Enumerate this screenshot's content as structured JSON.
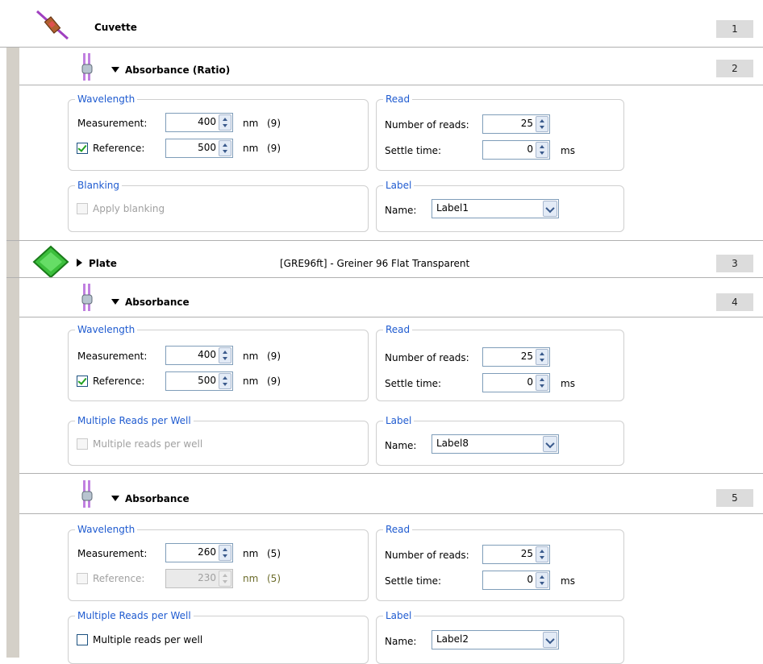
{
  "colors": {
    "legend": "#1f5bd0",
    "gutter": "#d4d0c8",
    "number_badge": "#dcdcdc",
    "check": "#21a121"
  },
  "steps": [
    {
      "number": "1",
      "title": "Cuvette",
      "icon": "cuvette-icon"
    },
    {
      "number": "2",
      "title": "Absorbance (Ratio)",
      "icon": "absorbance-probe-icon",
      "wavelength": {
        "legend": "Wavelength",
        "measurement_label": "Measurement:",
        "measurement_value": "400",
        "measurement_unit": "nm",
        "measurement_index": "(9)",
        "reference_label": "Reference:",
        "reference_checked": true,
        "reference_value": "500",
        "reference_unit": "nm",
        "reference_index": "(9)"
      },
      "read": {
        "legend": "Read",
        "reads_label": "Number of reads:",
        "reads_value": "25",
        "settle_label": "Settle time:",
        "settle_value": "0",
        "settle_unit": "ms"
      },
      "option": {
        "legend": "Blanking",
        "label": "Apply blanking",
        "checked": false,
        "enabled": false
      },
      "label": {
        "legend": "Label",
        "name_label": "Name:",
        "name_value": "Label1"
      }
    },
    {
      "number": "3",
      "title": "Plate",
      "icon": "plate-icon",
      "description": "[GRE96ft] - Greiner 96 Flat Transparent"
    },
    {
      "number": "4",
      "title": "Absorbance",
      "icon": "absorbance-probe-icon",
      "wavelength": {
        "legend": "Wavelength",
        "measurement_label": "Measurement:",
        "measurement_value": "400",
        "measurement_unit": "nm",
        "measurement_index": "(9)",
        "reference_label": "Reference:",
        "reference_checked": true,
        "reference_value": "500",
        "reference_unit": "nm",
        "reference_index": "(9)"
      },
      "read": {
        "legend": "Read",
        "reads_label": "Number of reads:",
        "reads_value": "25",
        "settle_label": "Settle time:",
        "settle_value": "0",
        "settle_unit": "ms"
      },
      "option": {
        "legend": "Multiple Reads per Well",
        "label": "Multiple reads per well",
        "checked": false,
        "enabled": false
      },
      "label": {
        "legend": "Label",
        "name_label": "Name:",
        "name_value": "Label8"
      }
    },
    {
      "number": "5",
      "title": "Absorbance",
      "icon": "absorbance-probe-icon",
      "wavelength": {
        "legend": "Wavelength",
        "measurement_label": "Measurement:",
        "measurement_value": "260",
        "measurement_unit": "nm",
        "measurement_index": "(5)",
        "reference_label": "Reference:",
        "reference_checked": false,
        "reference_enabled": false,
        "reference_value": "230",
        "reference_unit": "nm",
        "reference_index": "(5)"
      },
      "read": {
        "legend": "Read",
        "reads_label": "Number of reads:",
        "reads_value": "25",
        "settle_label": "Settle time:",
        "settle_value": "0",
        "settle_unit": "ms"
      },
      "option": {
        "legend": "Multiple Reads per Well",
        "label": "Multiple reads per well",
        "checked": false,
        "enabled": true
      },
      "label": {
        "legend": "Label",
        "name_label": "Name:",
        "name_value": "Label2"
      }
    }
  ]
}
